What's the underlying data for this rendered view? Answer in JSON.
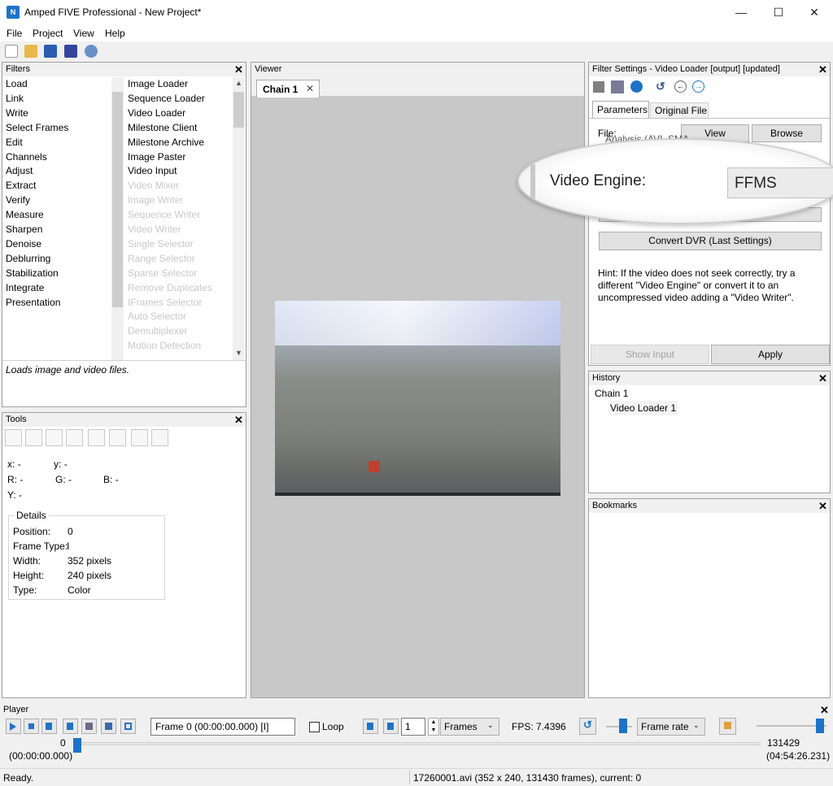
{
  "window": {
    "title": "Amped FIVE Professional - New Project*",
    "app_icon_text": "N",
    "controls": {
      "minimize": "—",
      "maximize": "☐",
      "close": "✕"
    }
  },
  "menu": [
    "File",
    "Project",
    "View",
    "Help"
  ],
  "filters": {
    "header": "Filters",
    "categories": [
      "Load",
      "Link",
      "Write",
      "Select Frames",
      "Edit",
      "Channels",
      "Adjust",
      "Extract",
      "Verify",
      "Measure",
      "Sharpen",
      "Denoise",
      "Deblurring",
      "Stabilization",
      "Integrate",
      "Presentation"
    ],
    "items_enabled": [
      "Image Loader",
      "Sequence Loader",
      "Video Loader",
      "Milestone Client",
      "Milestone Archive",
      "Image Paster",
      "Video Input"
    ],
    "items_disabled": [
      "Video Mixer",
      "Image Writer",
      "Sequence Writer",
      "Video Writer",
      "Single Selector",
      "Range Selector",
      "Sparse Selector",
      "Remove Duplicates",
      "IFrames Selector",
      "Auto Selector",
      "Demultiplexer",
      "Motion Detection"
    ],
    "description": "Loads image and video files."
  },
  "tools": {
    "header": "Tools",
    "x_label": "x:",
    "x_value": "-",
    "y_label": "y:",
    "y_value": "-",
    "r_label": "R:",
    "r_value": "-",
    "g_label": "G:",
    "g_value": "-",
    "b_label": "B:",
    "b_value": "-",
    "luma_label": "Y:",
    "luma_value": "-",
    "details": {
      "title": "Details",
      "rows": [
        {
          "label": "Position:",
          "value": "0"
        },
        {
          "label": "Frame Type:",
          "value": "I"
        },
        {
          "label": "Width:",
          "value": "352 pixels"
        },
        {
          "label": "Height:",
          "value": "240 pixels"
        },
        {
          "label": "Type:",
          "value": "Color"
        }
      ]
    }
  },
  "viewer": {
    "header": "Viewer",
    "tab": "Chain 1",
    "tab_close": "✕"
  },
  "filter_settings": {
    "header": "Filter Settings - Video Loader [output] [updated]",
    "tabs": [
      "Parameters",
      "Original File"
    ],
    "file_label": "File:",
    "view_button": "View",
    "browse_button": "Browse",
    "obscured_text": "Analysis (AVI_SMA",
    "magnifier_label": "Video Engine:",
    "magnifier_value": "FFMS",
    "obscured_button": "Convert DVR",
    "convert_button": "Convert DVR (Last Settings)",
    "hint": "Hint: If the video does not seek correctly, try a different \"Video Engine\" or convert it to an uncompressed video adding a \"Video Writer\".",
    "show_input_button": "Show Input",
    "apply_button": "Apply"
  },
  "history": {
    "header": "History",
    "chain": "Chain 1",
    "item": "Video Loader 1"
  },
  "bookmarks": {
    "header": "Bookmarks"
  },
  "player": {
    "header": "Player",
    "frame_field": "Frame 0 (00:00:00.000) [I]",
    "loop_label": "Loop",
    "step_value": "1",
    "unit_select": "Frames",
    "fps": "FPS: 7.4396",
    "rate_select": "Frame rate",
    "start_frame": "0",
    "start_time": "(00:00:00.000)",
    "end_frame": "131429",
    "end_time": "(04:54:26.231)",
    "position_fraction": 0.0,
    "rate_fraction": 0.2
  },
  "status": {
    "left": "Ready.",
    "right": "17260001.avi (352 x 240, 131430 frames), current: 0"
  },
  "colors": {
    "accent": "#1e73c8",
    "panel_border": "#a0a0a0",
    "viewer_bg": "#c8c8c8",
    "disabled_text": "#c8c8c8"
  }
}
